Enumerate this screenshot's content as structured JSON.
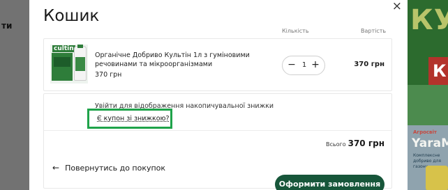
{
  "background": {
    "left_fragment": "ти",
    "banner_top_text": "КУЛ",
    "banner_red_text": "К",
    "banner_bottom_brand": "Агросвіт",
    "banner_bottom_title": "YaraMila",
    "banner_bottom_sub": "Комплексне добриво для газону"
  },
  "modal": {
    "title": "Кошик",
    "close_label": "×",
    "columns": {
      "quantity": "Кількість",
      "price": "Вартість"
    }
  },
  "cart_item": {
    "thumb_logo": "cultin",
    "name": "Органічне Добриво Культін 1л з гуміновими речовинами та мікроорганізмами",
    "unit_price": "370 грн",
    "quantity": "1",
    "minus_label": "−",
    "plus_label": "+",
    "total": "370 грн"
  },
  "discount": {
    "login_text": "Увійти для відображення накопичувальної знижки",
    "coupon_link": "Є купон зі знижкою?"
  },
  "summary": {
    "total_label": "Всього",
    "total_value": "370 грн"
  },
  "actions": {
    "back_arrow": "←",
    "back_label": "Повернутись до покупок",
    "checkout_label": "Оформити замовлення"
  },
  "colors": {
    "accent": "#17563a",
    "highlight": "#1fa34a",
    "overlay": "#6f6f6f"
  }
}
